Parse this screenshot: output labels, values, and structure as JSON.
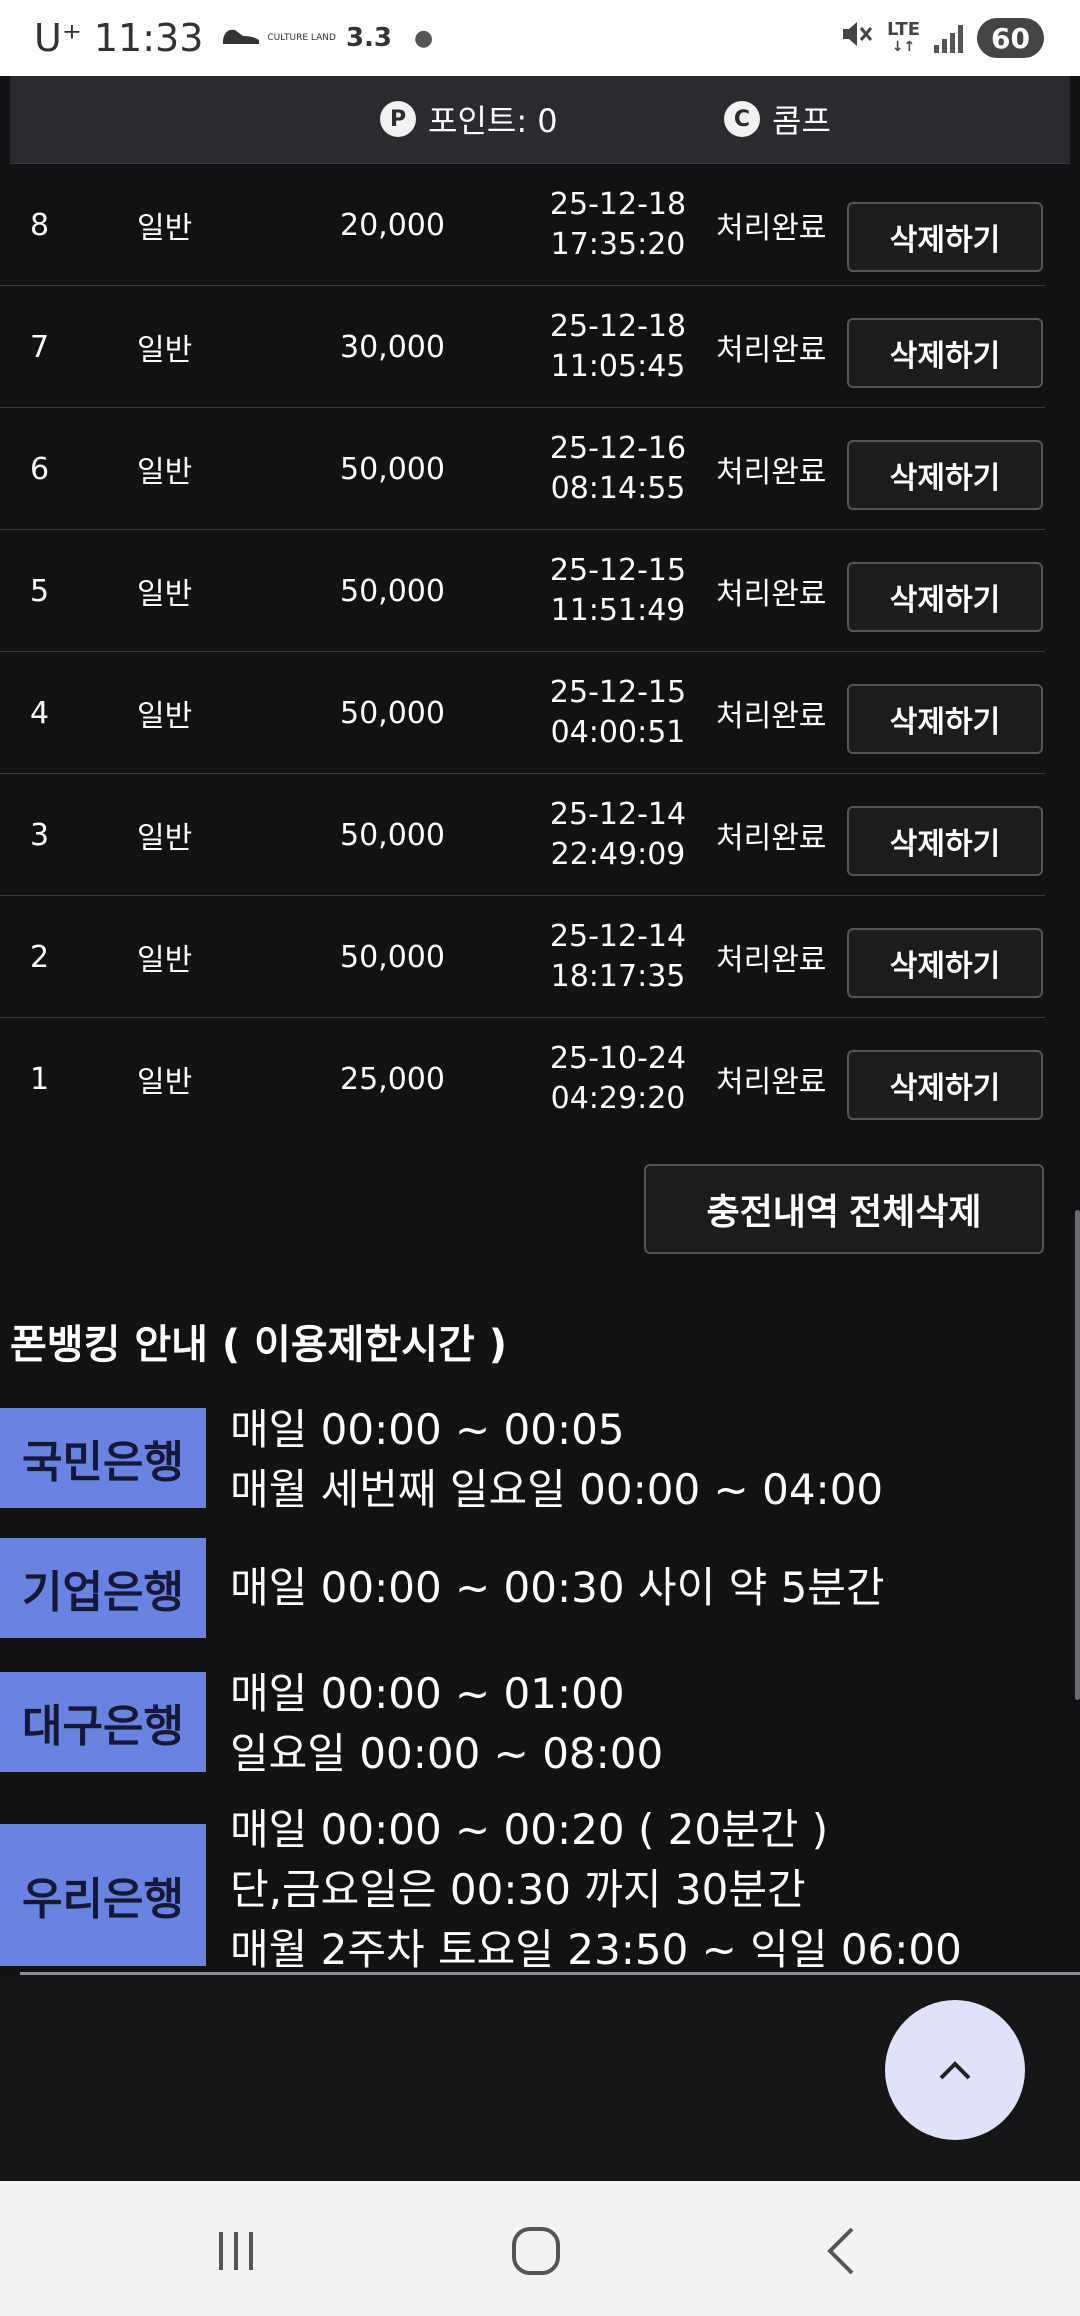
{
  "status_bar": {
    "carrier": "U⁺",
    "time": "11:33",
    "culture_land": "CULTURE LAND",
    "temperature": "3.3",
    "network": "LTE",
    "battery": "60"
  },
  "header": {
    "points_label": "포인트: 0",
    "comp_label": "콤프",
    "points_icon": "P",
    "comp_icon": "C"
  },
  "rows": [
    {
      "no": "8",
      "type": "일반",
      "amount": "20,000",
      "date": "25-12-18",
      "time": "17:35:20",
      "status": "처리완료",
      "action": "삭제하기"
    },
    {
      "no": "7",
      "type": "일반",
      "amount": "30,000",
      "date": "25-12-18",
      "time": "11:05:45",
      "status": "처리완료",
      "action": "삭제하기"
    },
    {
      "no": "6",
      "type": "일반",
      "amount": "50,000",
      "date": "25-12-16",
      "time": "08:14:55",
      "status": "처리완료",
      "action": "삭제하기"
    },
    {
      "no": "5",
      "type": "일반",
      "amount": "50,000",
      "date": "25-12-15",
      "time": "11:51:49",
      "status": "처리완료",
      "action": "삭제하기"
    },
    {
      "no": "4",
      "type": "일반",
      "amount": "50,000",
      "date": "25-12-15",
      "time": "04:00:51",
      "status": "처리완료",
      "action": "삭제하기"
    },
    {
      "no": "3",
      "type": "일반",
      "amount": "50,000",
      "date": "25-12-14",
      "time": "22:49:09",
      "status": "처리완료",
      "action": "삭제하기"
    },
    {
      "no": "2",
      "type": "일반",
      "amount": "50,000",
      "date": "25-12-14",
      "time": "18:17:35",
      "status": "처리완료",
      "action": "삭제하기"
    },
    {
      "no": "1",
      "type": "일반",
      "amount": "25,000",
      "date": "25-10-24",
      "time": "04:29:20",
      "status": "처리완료",
      "action": "삭제하기"
    }
  ],
  "delete_all_label": "충전내역 전체삭제",
  "info_title": "폰뱅킹 안내 ( 이용제한시간 )",
  "banks": [
    {
      "name": "국민은행",
      "lines": [
        "매일 00:00 ~ 00:05",
        "매월 세번째 일요일 00:00 ~ 04:00"
      ]
    },
    {
      "name": "기업은행",
      "lines": [
        "매일 00:00 ~ 00:30 사이 약 5분간"
      ]
    },
    {
      "name": "대구은행",
      "lines": [
        "매일 00:00 ~ 01:00",
        "일요일 00:00 ~ 08:00"
      ]
    },
    {
      "name": "우리은행",
      "lines": [
        "매일 00:00 ~ 00:20 ( 20분간 )",
        "단,금요일은 00:30 까지 30분간",
        "매월 2주차 토요일 23:50 ~ 익일 06:00"
      ]
    }
  ],
  "colors": {
    "background": "#121214",
    "bank_label_bg": "#6b83e0",
    "scroll_top_bg": "#dfe2f8"
  },
  "icons": {
    "scroll_top": "chevron-up-icon",
    "nav_recent": "recent-apps-icon",
    "nav_home": "home-icon",
    "nav_back": "back-icon"
  }
}
